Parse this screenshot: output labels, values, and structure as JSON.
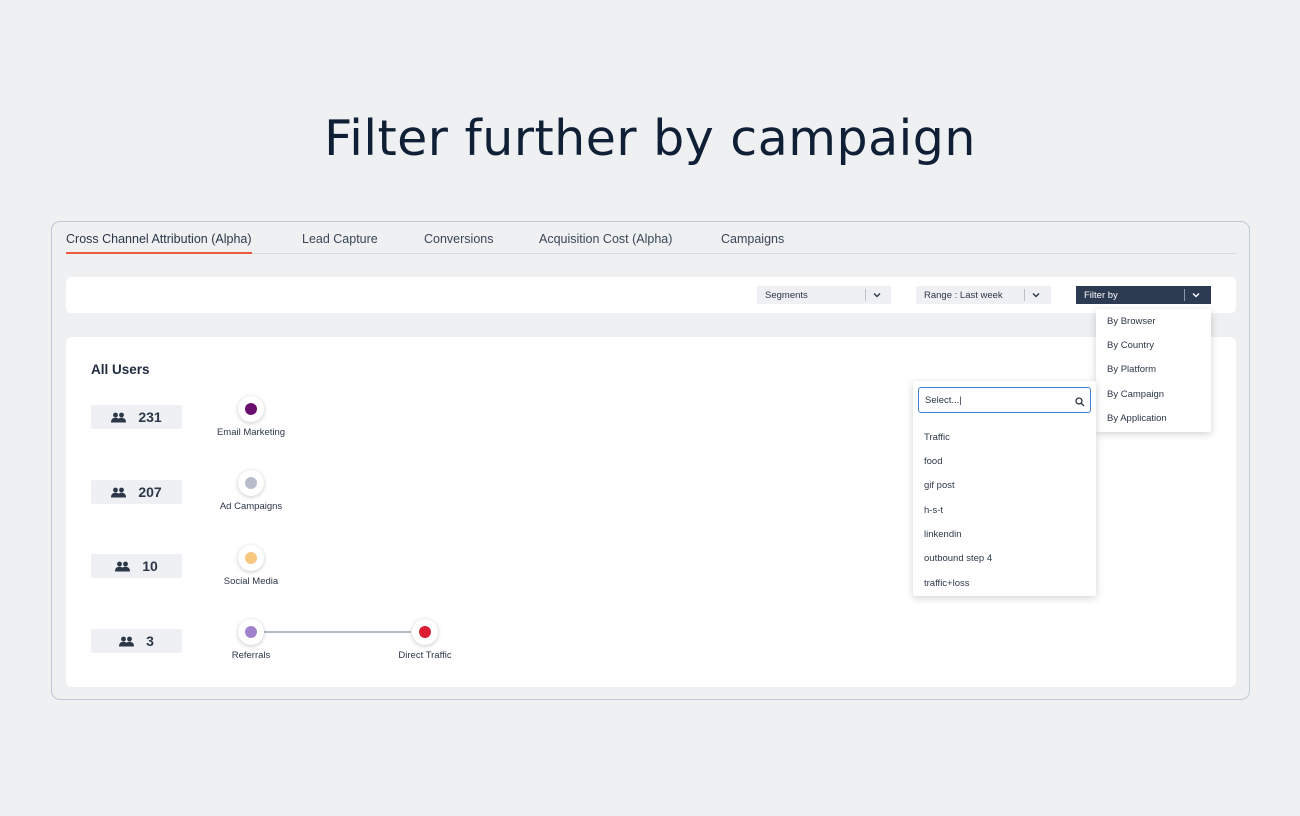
{
  "headline": "Filter further by campaign",
  "tabs": [
    {
      "label": "Cross Channel Attribution (Alpha)",
      "active": true
    },
    {
      "label": "Lead Capture",
      "active": false
    },
    {
      "label": "Conversions",
      "active": false
    },
    {
      "label": "Acquisition Cost (Alpha)",
      "active": false
    },
    {
      "label": "Campaigns",
      "active": false
    }
  ],
  "toolbar": {
    "segments_label": "Segments",
    "range_label": "Range : Last week",
    "filter_label": "Filter by"
  },
  "panel": {
    "title": "All Users",
    "rows": [
      {
        "count": "231",
        "nodes": [
          {
            "label": "Email Marketing",
            "color": "#6b0f6e"
          }
        ]
      },
      {
        "count": "207",
        "nodes": [
          {
            "label": "Ad Campaigns",
            "color": "#b8bccb"
          }
        ]
      },
      {
        "count": "10",
        "nodes": [
          {
            "label": "Social Media",
            "color": "#f6c77f"
          }
        ]
      },
      {
        "count": "3",
        "nodes": [
          {
            "label": "Referrals",
            "color": "#a183cc"
          },
          {
            "label": "Direct Traffic",
            "color": "#dc1d36"
          }
        ]
      }
    ]
  },
  "filter_menu": {
    "items": [
      "By Browser",
      "By Country",
      "By Platform",
      "By Campaign",
      "By Application"
    ]
  },
  "campaign_dropdown": {
    "search_value": "Select...|",
    "options": [
      "Traffic",
      "food",
      "gif post",
      "h-s-t",
      "linkendin",
      "outbound step 4",
      "traffic+loss"
    ]
  },
  "colors": {
    "accent_underline": "#f05a3c",
    "filter_button": "#2c3a52",
    "search_border": "#4a7fd1"
  },
  "icons": {
    "users": "users-icon",
    "chevron": "chevron-down-icon",
    "search": "search-icon"
  }
}
